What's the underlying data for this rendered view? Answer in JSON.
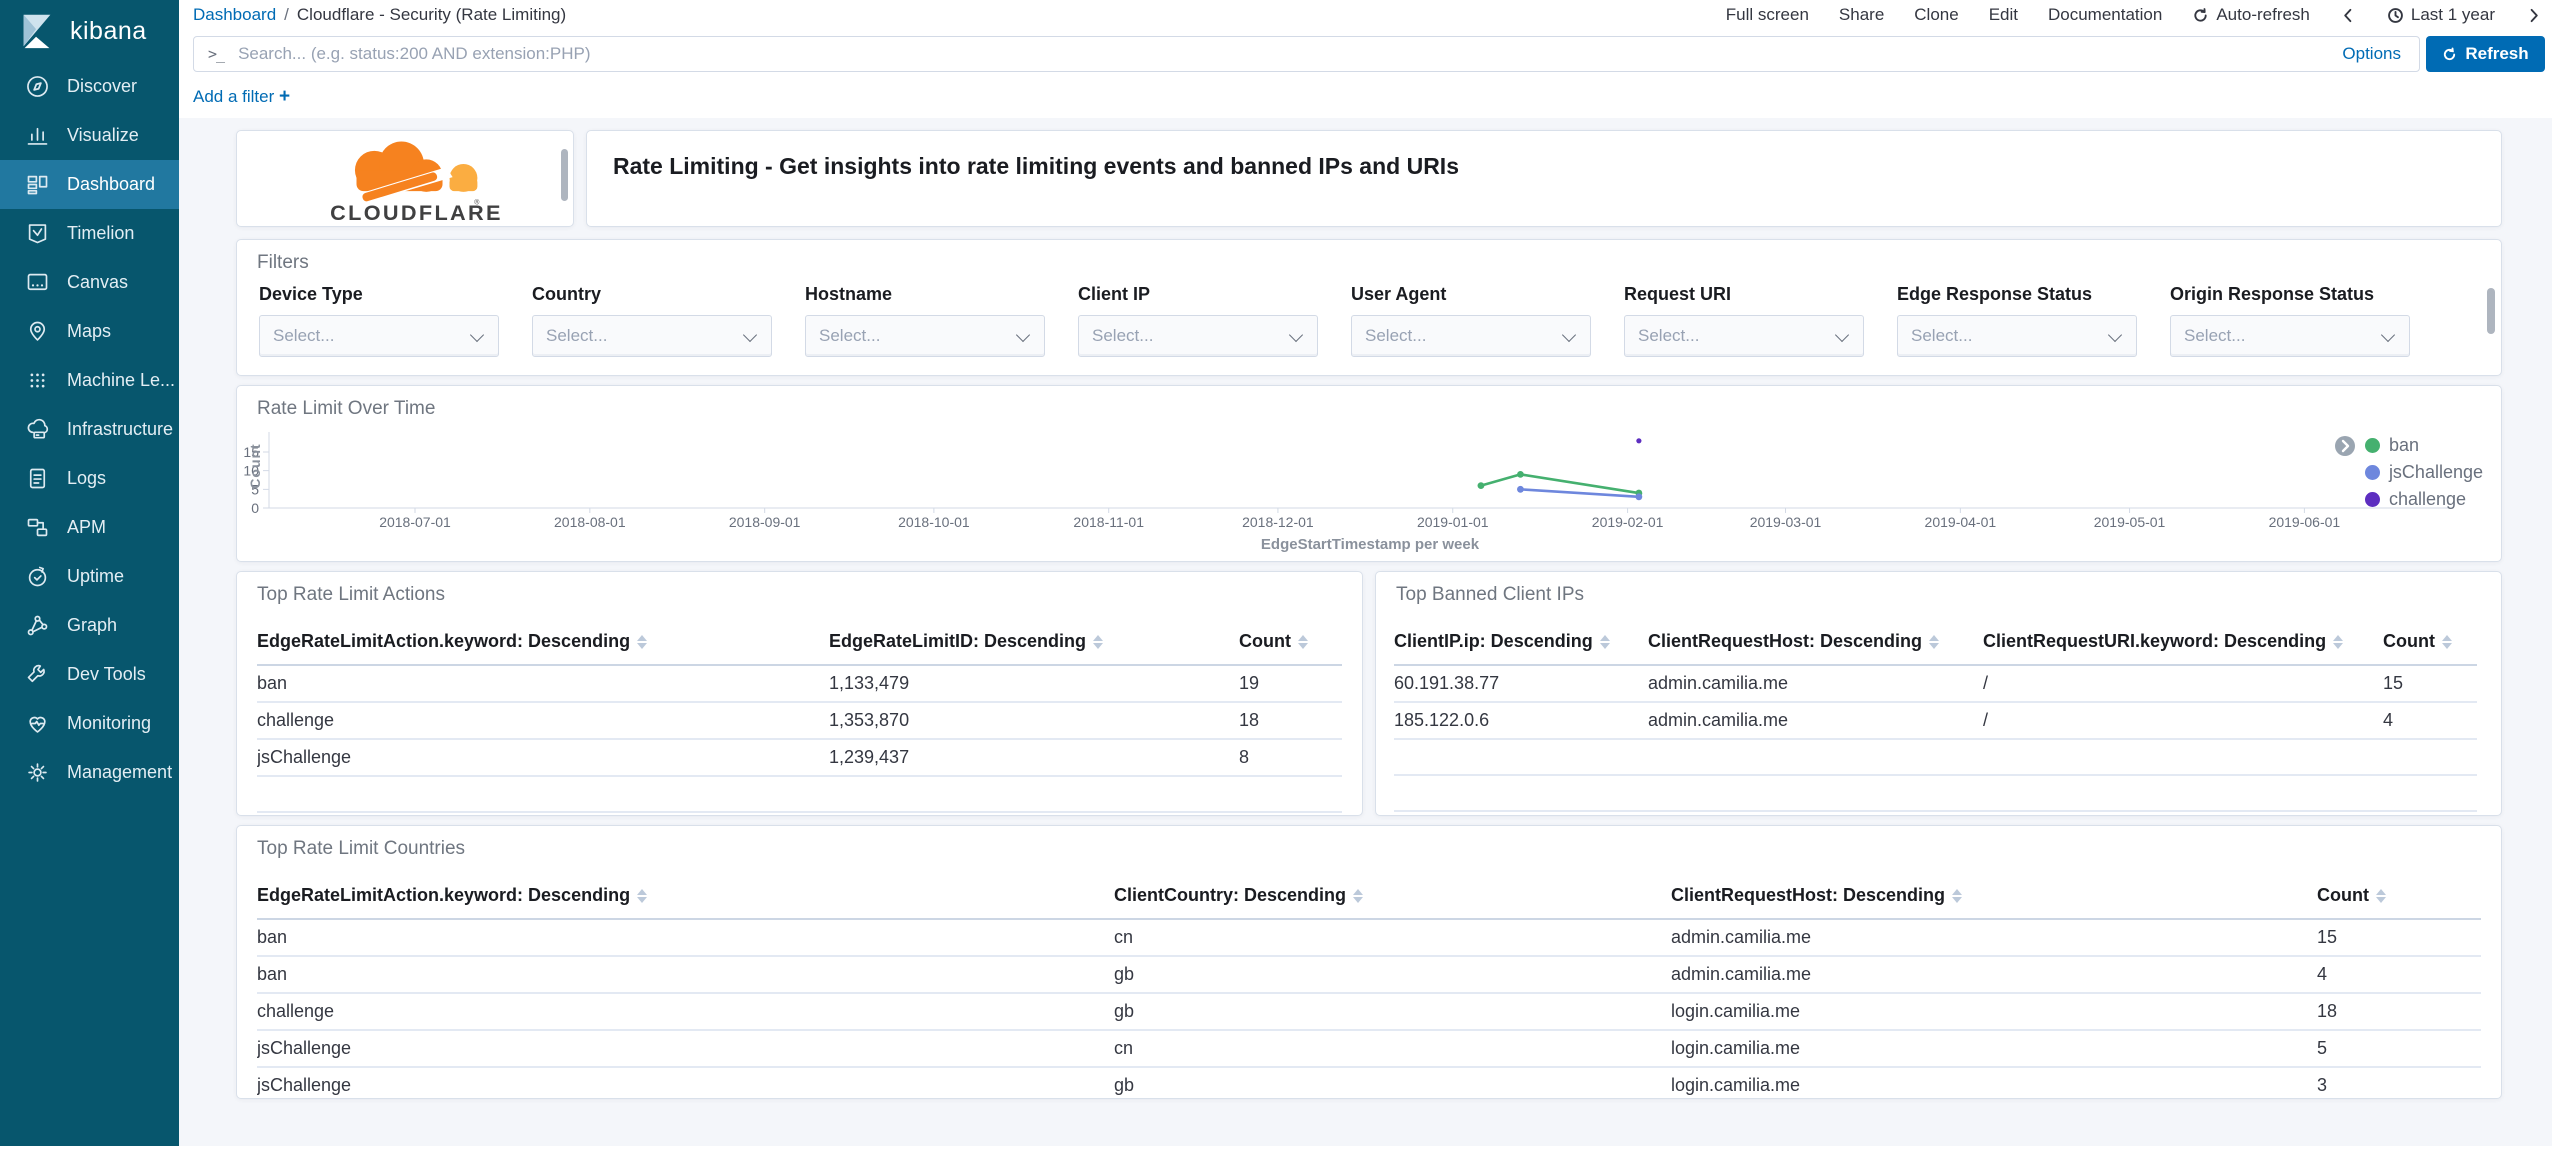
{
  "sidebar": {
    "logo_text": "kibana",
    "items": [
      "Discover",
      "Visualize",
      "Dashboard",
      "Timelion",
      "Canvas",
      "Maps",
      "Machine Le...",
      "Infrastructure",
      "Logs",
      "APM",
      "Uptime",
      "Graph",
      "Dev Tools",
      "Monitoring",
      "Management"
    ],
    "active_item": "Dashboard"
  },
  "topbar": {
    "breadcrumb": {
      "root": "Dashboard",
      "separator": "/",
      "current": "Cloudflare - Security (Rate Limiting)"
    },
    "menu_items": [
      "Full screen",
      "Share",
      "Clone",
      "Edit",
      "Documentation"
    ],
    "auto_refresh_label": "Auto-refresh",
    "time_range_label": "Last 1 year"
  },
  "search": {
    "prompt_glyph": ">_",
    "placeholder": "Search... (e.g. status:200 AND extension:PHP)",
    "options_label": "Options",
    "refresh_label": "Refresh"
  },
  "filter_bar": {
    "add_filter_label": "Add a filter",
    "plus_glyph": "+"
  },
  "panels": {
    "cloudflare": {
      "brand": "CLOUDFLARE",
      "registered_mark": "®"
    },
    "header": {
      "title": "Rate Limiting - Get insights into rate limiting events and banned IPs and URIs"
    },
    "filters": {
      "title": "Filters",
      "select_placeholder": "Select...",
      "fields": [
        "Device Type",
        "Country",
        "Hostname",
        "Client IP",
        "User Agent",
        "Request URI",
        "Edge Response Status",
        "Origin Response Status"
      ]
    },
    "actions_table": {
      "title": "Top Rate Limit Actions",
      "columns": [
        "EdgeRateLimitAction.keyword: Descending",
        "EdgeRateLimitID: Descending",
        "Count"
      ],
      "rows": [
        [
          "ban",
          "1,133,479",
          "19"
        ],
        [
          "challenge",
          "1,353,870",
          "18"
        ],
        [
          "jsChallenge",
          "1,239,437",
          "8"
        ]
      ]
    },
    "banned_table": {
      "title": "Top Banned Client IPs",
      "columns": [
        "ClientIP.ip: Descending",
        "ClientRequestHost: Descending",
        "ClientRequestURI.keyword: Descending",
        "Count"
      ],
      "rows": [
        [
          "60.191.38.77",
          "admin.camilia.me",
          "/",
          "15"
        ],
        [
          "185.122.0.6",
          "admin.camilia.me",
          "/",
          "4"
        ]
      ]
    },
    "countries_table": {
      "title": "Top Rate Limit Countries",
      "columns": [
        "EdgeRateLimitAction.keyword: Descending",
        "ClientCountry: Descending",
        "ClientRequestHost: Descending",
        "Count"
      ],
      "rows": [
        [
          "ban",
          "cn",
          "admin.camilia.me",
          "15"
        ],
        [
          "ban",
          "gb",
          "admin.camilia.me",
          "4"
        ],
        [
          "challenge",
          "gb",
          "login.camilia.me",
          "18"
        ],
        [
          "jsChallenge",
          "cn",
          "login.camilia.me",
          "5"
        ],
        [
          "jsChallenge",
          "gb",
          "login.camilia.me",
          "3"
        ]
      ]
    }
  },
  "chart_data": {
    "type": "line",
    "title": "Rate Limit Over Time",
    "xlabel": "EdgeStartTimestamp per week",
    "ylabel": "Count",
    "ylim": [
      0,
      18
    ],
    "y_ticks": [
      0,
      5,
      10,
      15
    ],
    "x_ticks": [
      "2018-07-01",
      "2018-08-01",
      "2018-09-01",
      "2018-10-01",
      "2018-11-01",
      "2018-12-01",
      "2019-01-01",
      "2019-02-01",
      "2019-03-01",
      "2019-04-01",
      "2019-05-01",
      "2019-06-01"
    ],
    "legend_position": "right",
    "series": [
      {
        "name": "ban",
        "color": "#45b06f",
        "points": [
          [
            "2019-01-06",
            6
          ],
          [
            "2019-01-13",
            9
          ],
          [
            "2019-02-03",
            4
          ]
        ]
      },
      {
        "name": "jsChallenge",
        "color": "#6e87dd",
        "points": [
          [
            "2019-01-13",
            5
          ],
          [
            "2019-02-03",
            3
          ]
        ]
      },
      {
        "name": "challenge",
        "color": "#5d2ec0",
        "points": [
          [
            "2019-02-03",
            18
          ]
        ]
      }
    ]
  }
}
